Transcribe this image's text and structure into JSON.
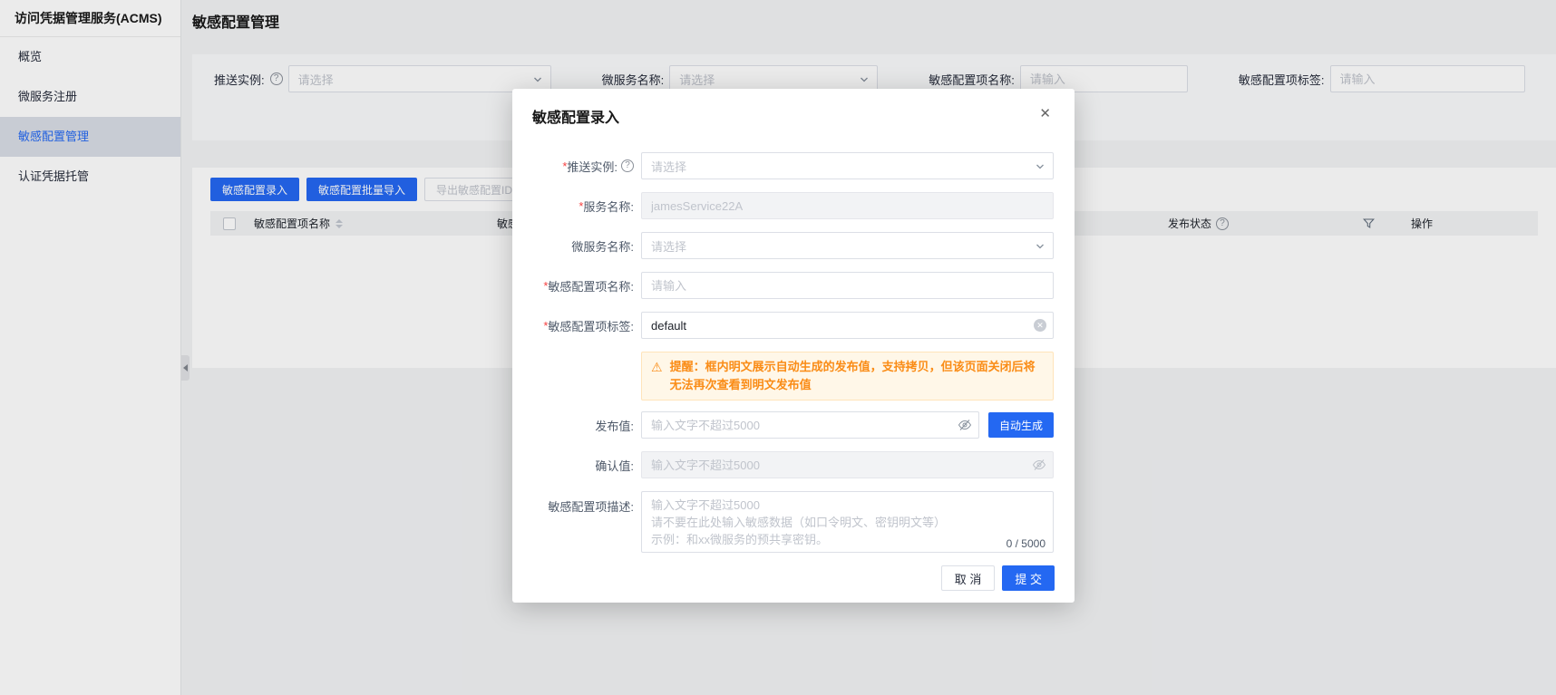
{
  "colors": {
    "primary": "#2468f2",
    "active-bg": "#d9dee6",
    "required": "#f53f3f",
    "warning-bg": "#fff7e8",
    "warning-border": "#ffe4ba",
    "warning-text": "#fa8c16"
  },
  "sidebar": {
    "title": "访问凭据管理服务(ACMS)",
    "items": [
      {
        "label": "概览"
      },
      {
        "label": "微服务注册"
      },
      {
        "label": "敏感配置管理"
      },
      {
        "label": "认证凭据托管"
      }
    ]
  },
  "page": {
    "title": "敏感配置管理"
  },
  "filters": [
    {
      "label": "推送实例:",
      "placeholder": "请选择"
    },
    {
      "label": "微服务名称:",
      "placeholder": "请选择"
    },
    {
      "label": "敏感配置项名称:",
      "placeholder": "请输入"
    },
    {
      "label": "敏感配置项标签:",
      "placeholder": "请输入"
    }
  ],
  "toolbar": {
    "buttons": [
      {
        "label": "敏感配置录入"
      },
      {
        "label": "敏感配置批量导入"
      },
      {
        "label": "导出敏感配置ID"
      }
    ]
  },
  "table": {
    "columns": [
      {
        "label": "敏感配置项名称"
      },
      {
        "label": "敏感"
      },
      {
        "label": "发布状态"
      },
      {
        "label": "操作"
      }
    ]
  },
  "modal": {
    "title": "敏感配置录入",
    "close_icon": "✕",
    "warning_icon": "⚠",
    "warning": "提醒：框内明文展示自动生成的发布值，支持拷贝，但该页面关闭后将无法再次查看到明文发布值",
    "rows": {
      "push_instance": {
        "label": "推送实例:",
        "placeholder": "请选择"
      },
      "service_name": {
        "label": "服务名称:",
        "value": "jamesService22A"
      },
      "microservice": {
        "label": "微服务名称:",
        "placeholder": "请选择"
      },
      "config_name": {
        "label": "敏感配置项名称:",
        "placeholder": "请输入"
      },
      "config_tag": {
        "label": "敏感配置项标签:",
        "value": "default"
      },
      "publish_value": {
        "label": "发布值:",
        "placeholder": "输入文字不超过5000",
        "generate": "自动生成"
      },
      "confirm_value": {
        "label": "确认值:",
        "placeholder": "输入文字不超过5000"
      },
      "description": {
        "label": "敏感配置项描述:",
        "placeholder_line1": "输入文字不超过5000",
        "placeholder_line2": "请不要在此处输入敏感数据（如口令明文、密钥明文等）",
        "placeholder_line3": "示例：和xx微服务的预共享密钥。",
        "counter": "0 / 5000"
      }
    },
    "footer": {
      "cancel": "取 消",
      "submit": "提 交"
    }
  }
}
